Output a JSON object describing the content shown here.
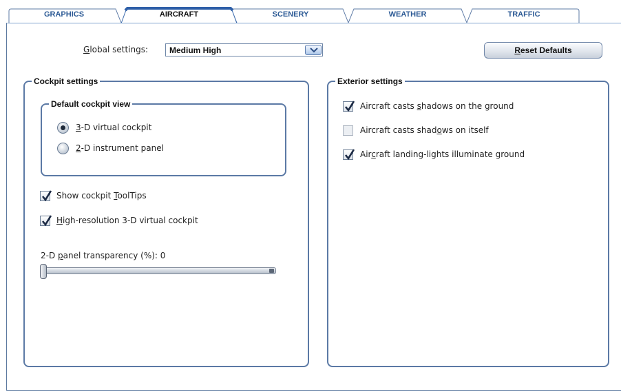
{
  "tabs": [
    {
      "label": "GRAPHICS",
      "active": false
    },
    {
      "label": "AIRCRAFT",
      "active": true
    },
    {
      "label": "SCENERY",
      "active": false
    },
    {
      "label": "WEATHER",
      "active": false
    },
    {
      "label": "TRAFFIC",
      "active": false
    }
  ],
  "global": {
    "label_pre": "",
    "label_underlined": "G",
    "label_post": "lobal settings:",
    "value": "Medium High",
    "dropdown_icon": "chevron-down-icon"
  },
  "reset_button": {
    "underlined": "R",
    "rest": "eset Defaults"
  },
  "cockpit": {
    "title": "Cockpit settings",
    "default_view": {
      "title": "Default cockpit view",
      "options": [
        {
          "underlined": "3",
          "rest": "-D virtual cockpit",
          "selected": true
        },
        {
          "underlined": "2",
          "rest": "-D instrument panel",
          "selected": false
        }
      ]
    },
    "checkboxes": [
      {
        "pre": "Show cockpit ",
        "underlined": "T",
        "post": "oolTips",
        "checked": true
      },
      {
        "pre": "",
        "underlined": "H",
        "post": "igh-resolution 3-D virtual cockpit",
        "checked": true
      }
    ],
    "slider": {
      "pre": "2-D ",
      "underlined": "p",
      "post": "anel transparency (%): 0",
      "value": 0,
      "min": 0,
      "max": 100
    }
  },
  "exterior": {
    "title": "Exterior settings",
    "checkboxes": [
      {
        "pre": "Aircraft casts ",
        "underlined": "s",
        "post": "hadows on the ground",
        "checked": true
      },
      {
        "pre": "Aircraft casts shad",
        "underlined": "o",
        "post": "ws on itself",
        "checked": false
      },
      {
        "pre": "Air",
        "underlined": "c",
        "post": "raft landing-lights illuminate ground",
        "checked": true
      }
    ]
  },
  "colors": {
    "accent": "#2c5a95",
    "border": "#5b79a5",
    "active_tab_top": "#2e5fa8"
  }
}
